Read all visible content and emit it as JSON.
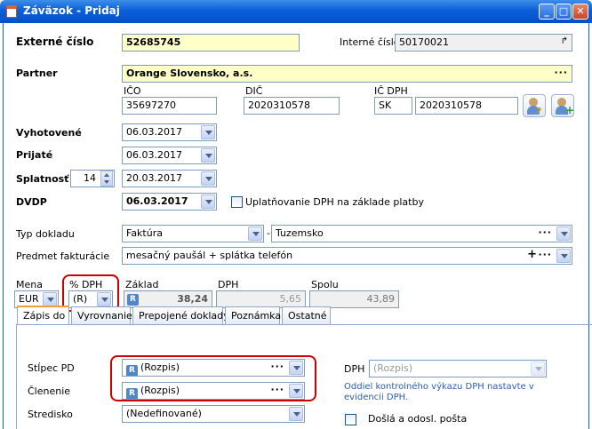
{
  "window": {
    "title": "Záväzok - Pridaj",
    "btn_min": "_",
    "btn_max": "□",
    "btn_close": "✕"
  },
  "header": {
    "ext_label": "Externé číslo",
    "ext_value": "52685745",
    "int_label": "Interné číslo",
    "int_value": "50170021"
  },
  "partner": {
    "label": "Partner",
    "value": "Orange Slovensko, a.s.",
    "dots": "···",
    "ico_label": "IČO",
    "ico_value": "35697270",
    "dic_label": "DIČ",
    "dic_value": "2020310578",
    "icdph_label": "IČ DPH",
    "icdph_prefix": "SK",
    "icdph_value": "2020310578"
  },
  "dates": {
    "vyhotovene_label": "Vyhotovené",
    "vyhotovene_value": "06.03.2017",
    "prijate_label": "Prijaté",
    "prijate_value": "06.03.2017",
    "splatnost_label": "Splatnosť",
    "splatnost_days": "14",
    "splatnost_value": "20.03.2017",
    "dvdp_label": "DVDP",
    "dvdp_value": "06.03.2017",
    "uplatnovanie_label": "Uplatňovanie DPH na základe platby"
  },
  "doc": {
    "typ_label": "Typ dokladu",
    "typ_value": "Faktúra",
    "dash": "-",
    "typ2_value": "Tuzemsko",
    "dots": "···",
    "predmet_label": "Predmet fakturácie",
    "predmet_value": "mesačný paušál + splátka telefón",
    "plus": "+"
  },
  "amounts": {
    "mena_label": "Mena",
    "mena_value": "EUR",
    "dph_pct_label": "% DPH",
    "dph_pct_value": "(R)",
    "zaklad_label": "Základ",
    "zaklad_badge": "R",
    "zaklad_value": "38,24",
    "dph_label": "DPH",
    "dph_value": "5,65",
    "spolu_label": "Spolu",
    "spolu_value": "43,89"
  },
  "tabs": [
    "Zápis do",
    "Vyrovnanie",
    "Prepojené doklady",
    "Poznámka",
    "Ostatné"
  ],
  "zapis": {
    "stlpec_label": "Stĺpec PD",
    "stlpec_badge": "R",
    "stlpec_value": "(Rozpis)",
    "clenenie_label": "Členenie",
    "clenenie_badge": "R",
    "clenenie_value": "(Rozpis)",
    "stredisko_label": "Stredisko",
    "stredisko_value": "(Nedefinované)",
    "dph_label": "DPH",
    "dph_value": "(Rozpis)",
    "note": "Oddiel kontrolného výkazu DPH nastavte v evidencii DPH.",
    "dosla_label": "Došlá a odosl. pošta",
    "dots": "···"
  },
  "colors": {
    "titlebar": "#0a5fd8",
    "highlight": "#cc0000",
    "required_bg": "#ffffc8"
  }
}
